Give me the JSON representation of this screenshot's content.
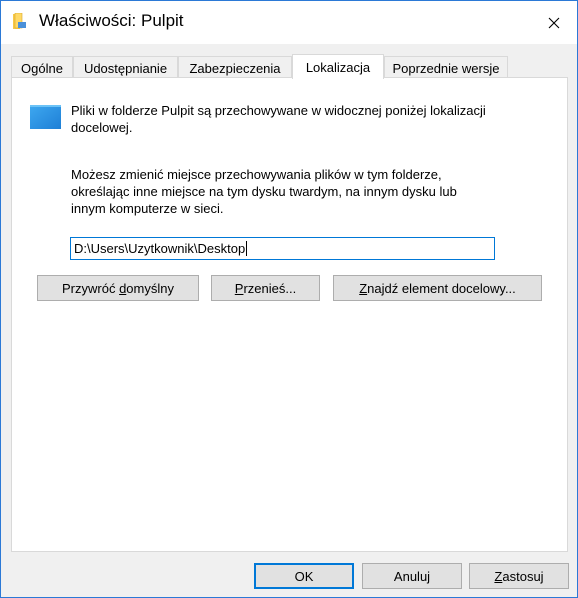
{
  "window": {
    "title": "Właściwości: Pulpit"
  },
  "tabs": [
    {
      "label": "Ogólne"
    },
    {
      "label": "Udostępnianie"
    },
    {
      "label": "Zabezpieczenia"
    },
    {
      "label": "Lokalizacja",
      "active": true
    },
    {
      "label": "Poprzednie wersje"
    }
  ],
  "location": {
    "description": "Pliki w folderze Pulpit są przechowywane w widocznej poniżej lokalizacji docelowej.",
    "info": "Możesz zmienić miejsce przechowywania plików w tym folderze, określając inne miejsce na tym dysku twardym, na innym dysku lub innym komputerze w sieci.",
    "path_value": "D:\\Users\\Uzytkownik\\Desktop",
    "restore_label_pre": "Przywróć ",
    "restore_label_key": "d",
    "restore_label_post": "omyślny",
    "move_label_pre": "",
    "move_label_key": "P",
    "move_label_post": "rzenieś...",
    "find_label_pre": "",
    "find_label_key": "Z",
    "find_label_post": "najdź element docelowy..."
  },
  "footer": {
    "ok_label": "OK",
    "cancel_label": "Anuluj",
    "apply_label_key": "Z",
    "apply_label_post": "astosuj"
  },
  "colors": {
    "accent": "#0078d7",
    "border": "#2b79d6",
    "button_bg": "#e1e1e1",
    "dialog_bg": "#f0f0f0"
  },
  "icons": {
    "title": "folder-icon",
    "close": "close-icon",
    "location": "desktop-folder-icon"
  }
}
